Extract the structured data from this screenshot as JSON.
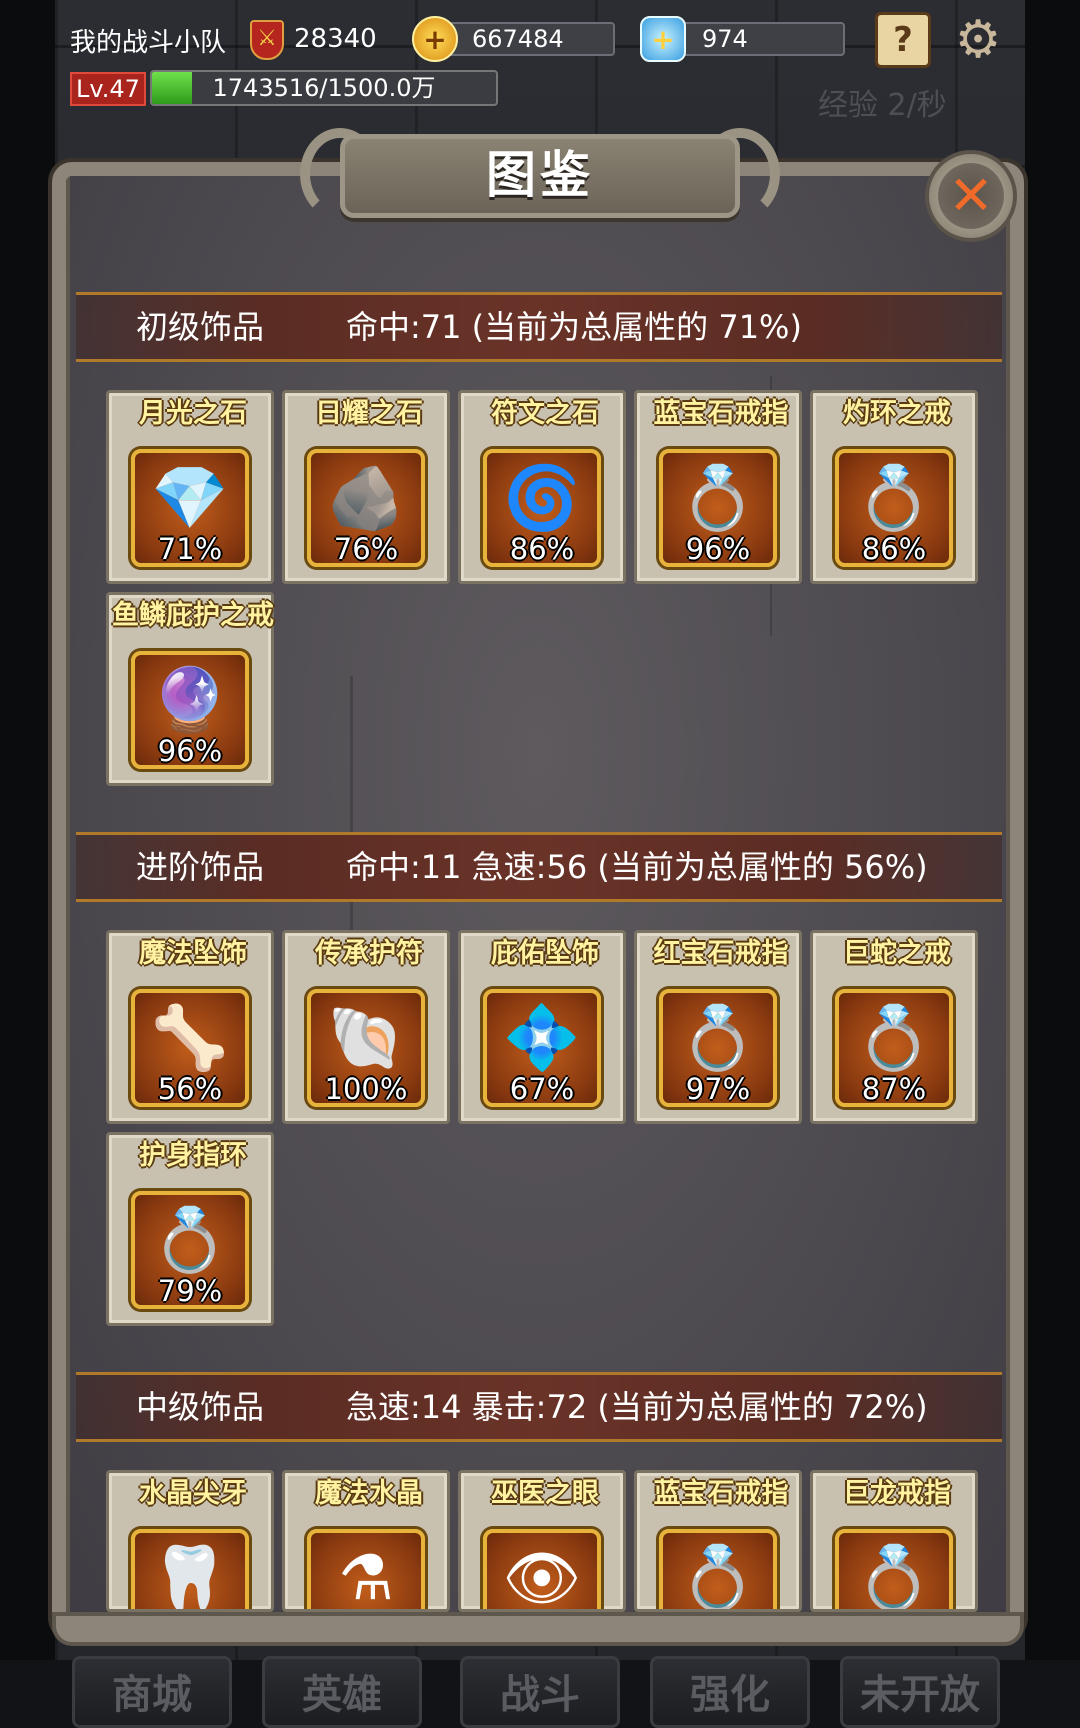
{
  "hud": {
    "team_name": "我的战斗小队",
    "power": "28340",
    "gold": "667484",
    "gems": "974",
    "level": "Lv.47",
    "exp_text": "1743516/1500.0万",
    "exp_fraction": 0.116,
    "exp_rate": "经验 2/秒"
  },
  "panel": {
    "title": "图鉴",
    "close_symbol": "✕"
  },
  "sections": [
    {
      "name": "初级饰品",
      "stat": "命中:71 (当前为总属性的 71%)",
      "items": [
        {
          "label": "月光之石",
          "pct": "71%",
          "icon": "moonstone-icon",
          "glyph": "💎"
        },
        {
          "label": "日耀之石",
          "pct": "76%",
          "icon": "sunstone-icon",
          "glyph": "🪨"
        },
        {
          "label": "符文之石",
          "pct": "86%",
          "icon": "runestone-icon",
          "glyph": "🌀"
        },
        {
          "label": "蓝宝石戒指",
          "pct": "96%",
          "icon": "sapphire-ring-icon",
          "glyph": "💍"
        },
        {
          "label": "灼环之戒",
          "pct": "86%",
          "icon": "burning-ring-icon",
          "glyph": "💍"
        },
        {
          "label": "鱼鳞庇护之戒",
          "pct": "96%",
          "icon": "fishscale-ring-icon",
          "glyph": "🔮"
        }
      ]
    },
    {
      "name": "进阶饰品",
      "stat": "命中:11  急速:56 (当前为总属性的 56%)",
      "items": [
        {
          "label": "魔法坠饰",
          "pct": "56%",
          "icon": "magic-pendant-icon",
          "glyph": "🦴"
        },
        {
          "label": "传承护符",
          "pct": "100%",
          "icon": "heritage-amulet-icon",
          "glyph": "🐚"
        },
        {
          "label": "庇佑坠饰",
          "pct": "67%",
          "icon": "blessing-pendant-icon",
          "glyph": "💠"
        },
        {
          "label": "红宝石戒指",
          "pct": "97%",
          "icon": "ruby-ring-icon",
          "glyph": "💍"
        },
        {
          "label": "巨蛇之戒",
          "pct": "87%",
          "icon": "serpent-ring-icon",
          "glyph": "💍"
        },
        {
          "label": "护身指环",
          "pct": "79%",
          "icon": "guardian-ring-icon",
          "glyph": "💍"
        }
      ]
    },
    {
      "name": "中级饰品",
      "stat": "急速:14  暴击:72 (当前为总属性的 72%)",
      "items": [
        {
          "label": "水晶尖牙",
          "pct": "",
          "icon": "crystal-fang-icon",
          "glyph": "🦷"
        },
        {
          "label": "魔法水晶",
          "pct": "",
          "icon": "magic-crystal-icon",
          "glyph": "⚗"
        },
        {
          "label": "巫医之眼",
          "pct": "",
          "icon": "witch-eye-icon",
          "glyph": "👁"
        },
        {
          "label": "蓝宝石戒指",
          "pct": "",
          "icon": "sapphire-ring-2-icon",
          "glyph": "💍"
        },
        {
          "label": "巨龙戒指",
          "pct": "",
          "icon": "dragon-ring-icon",
          "glyph": "💍"
        }
      ]
    }
  ],
  "nav": [
    "商城",
    "英雄",
    "战斗",
    "强化",
    "未开放"
  ]
}
